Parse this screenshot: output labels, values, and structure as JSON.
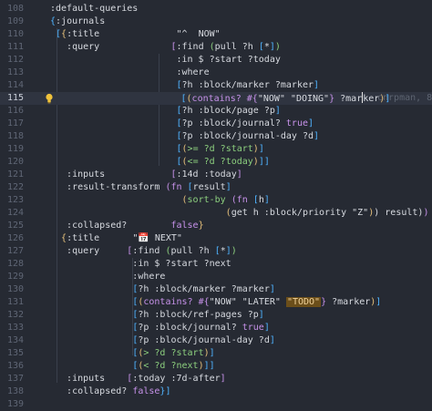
{
  "editor": {
    "blame_text": "cnrpman, 8",
    "lines": [
      {
        "n": "108",
        "segs": [
          [
            ":default-queries",
            "kw"
          ]
        ]
      },
      {
        "n": "109",
        "segs": [
          [
            "{",
            "br"
          ],
          [
            ":journals",
            "kw"
          ]
        ]
      },
      {
        "n": "110",
        "segs": [
          [
            " [",
            "br"
          ],
          [
            "{",
            "y"
          ],
          [
            ":title              ",
            "kw"
          ],
          [
            "\"^  NOW\"",
            "str"
          ]
        ]
      },
      {
        "n": "111",
        "segs": [
          [
            "   :query             ",
            "kw"
          ],
          [
            "[",
            "p"
          ],
          [
            ":find ",
            "kw"
          ],
          [
            "(",
            "g"
          ],
          [
            "pull ?h ",
            "kw"
          ],
          [
            "[",
            "br"
          ],
          [
            "*",
            "kw"
          ],
          [
            "]",
            "br"
          ],
          [
            ")",
            "g"
          ]
        ]
      },
      {
        "n": "112",
        "segs": [
          [
            "                       :in $ ?start ?today",
            "kw"
          ]
        ]
      },
      {
        "n": "113",
        "segs": [
          [
            "                       :where",
            "kw"
          ]
        ]
      },
      {
        "n": "114",
        "segs": [
          [
            "                       ",
            "kw"
          ],
          [
            "[",
            "br"
          ],
          [
            "?h :block/marker ?marker",
            "kw"
          ],
          [
            "]",
            "br"
          ]
        ]
      },
      {
        "n": "115",
        "segs": [
          [
            "                       ",
            "kw"
          ],
          [
            "[",
            "br"
          ],
          [
            "(",
            "y"
          ],
          [
            "contains? ",
            "fn"
          ],
          [
            "#{",
            "p"
          ],
          [
            "\"NOW\" \"DOING\"",
            "str"
          ],
          [
            "}",
            "p"
          ],
          [
            " ?mar",
            "kw"
          ],
          [
            "|",
            "cursor"
          ],
          [
            "ker",
            "kw"
          ],
          [
            ")",
            "y"
          ],
          [
            "]",
            "br"
          ]
        ],
        "current": true
      },
      {
        "n": "116",
        "segs": [
          [
            "                       ",
            "kw"
          ],
          [
            "[",
            "br"
          ],
          [
            "?h :block/page ?p",
            "kw"
          ],
          [
            "]",
            "br"
          ]
        ]
      },
      {
        "n": "117",
        "segs": [
          [
            "                       ",
            "kw"
          ],
          [
            "[",
            "br"
          ],
          [
            "?p :block/journal? ",
            "kw"
          ],
          [
            "true",
            "bool"
          ],
          [
            "]",
            "br"
          ]
        ]
      },
      {
        "n": "118",
        "segs": [
          [
            "                       ",
            "kw"
          ],
          [
            "[",
            "br"
          ],
          [
            "?p :block/journal-day ?d",
            "kw"
          ],
          [
            "]",
            "br"
          ]
        ]
      },
      {
        "n": "119",
        "segs": [
          [
            "                       ",
            "kw"
          ],
          [
            "[",
            "br"
          ],
          [
            "(",
            "y"
          ],
          [
            ">= ?d ?start",
            "g"
          ],
          [
            ")",
            "y"
          ],
          [
            "]",
            "br"
          ]
        ]
      },
      {
        "n": "120",
        "segs": [
          [
            "                       ",
            "kw"
          ],
          [
            "[",
            "br"
          ],
          [
            "(",
            "y"
          ],
          [
            "<= ?d ?today",
            "g"
          ],
          [
            ")",
            "y"
          ],
          [
            "]]",
            "br"
          ]
        ]
      },
      {
        "n": "121",
        "segs": [
          [
            "   :inputs            ",
            "kw"
          ],
          [
            "[",
            "p"
          ],
          [
            ":14d :today",
            "kw"
          ],
          [
            "]",
            "p"
          ]
        ]
      },
      {
        "n": "122",
        "segs": [
          [
            "   :result-transform ",
            "kw"
          ],
          [
            "(",
            "p"
          ],
          [
            "fn ",
            "fn"
          ],
          [
            "[",
            "br"
          ],
          [
            "result",
            "kw"
          ],
          [
            "]",
            "br"
          ]
        ]
      },
      {
        "n": "123",
        "segs": [
          [
            "                        ",
            "kw"
          ],
          [
            "(",
            "y"
          ],
          [
            "sort-by ",
            "g"
          ],
          [
            "(",
            "p"
          ],
          [
            "fn ",
            "fn"
          ],
          [
            "[",
            "br"
          ],
          [
            "h",
            "kw"
          ],
          [
            "]",
            "br"
          ]
        ]
      },
      {
        "n": "124",
        "segs": [
          [
            "                                ",
            "kw"
          ],
          [
            "(",
            "y"
          ],
          [
            "get h :block/priority \"Z\"",
            "kw"
          ],
          [
            ")",
            "y"
          ],
          [
            ") result",
            ""
          ],
          [
            ")",
            ""
          ],
          [
            ")",
            "p"
          ]
        ]
      },
      {
        "n": "125",
        "segs": [
          [
            "   :collapsed?        ",
            "kw"
          ],
          [
            "false",
            "bool"
          ],
          [
            "}",
            "y"
          ]
        ]
      },
      {
        "n": "126",
        "segs": [
          [
            "  ",
            "kw"
          ],
          [
            "{",
            "y"
          ],
          [
            ":title      ",
            "kw"
          ],
          [
            "\"📅 NEXT\"",
            "str"
          ]
        ]
      },
      {
        "n": "127",
        "segs": [
          [
            "   :query     ",
            "kw"
          ],
          [
            "[",
            "p"
          ],
          [
            ":find ",
            "kw"
          ],
          [
            "(",
            "g"
          ],
          [
            "pull ?h ",
            "kw"
          ],
          [
            "[",
            "br"
          ],
          [
            "*",
            "kw"
          ],
          [
            "]",
            "br"
          ],
          [
            ")",
            "g"
          ]
        ]
      },
      {
        "n": "128",
        "segs": [
          [
            "               :in $ ?start ?next",
            "kw"
          ]
        ]
      },
      {
        "n": "129",
        "segs": [
          [
            "               :where",
            "kw"
          ]
        ]
      },
      {
        "n": "130",
        "segs": [
          [
            "               ",
            "kw"
          ],
          [
            "[",
            "br"
          ],
          [
            "?h :block/marker ?marker",
            "kw"
          ],
          [
            "]",
            "br"
          ]
        ]
      },
      {
        "n": "131",
        "segs": [
          [
            "               ",
            "kw"
          ],
          [
            "[",
            "br"
          ],
          [
            "(",
            "y"
          ],
          [
            "contains? ",
            "fn"
          ],
          [
            "#{",
            "p"
          ],
          [
            "\"NOW\" \"LATER\" ",
            "str"
          ],
          [
            "\"TODO\"",
            "todo"
          ],
          [
            "}",
            "p"
          ],
          [
            " ?marker",
            "kw"
          ],
          [
            ")",
            "y"
          ],
          [
            "]",
            "br"
          ]
        ]
      },
      {
        "n": "132",
        "segs": [
          [
            "               ",
            "kw"
          ],
          [
            "[",
            "br"
          ],
          [
            "?h :block/ref-pages ?p",
            "kw"
          ],
          [
            "]",
            "br"
          ]
        ]
      },
      {
        "n": "133",
        "segs": [
          [
            "               ",
            "kw"
          ],
          [
            "[",
            "br"
          ],
          [
            "?p :block/journal? ",
            "kw"
          ],
          [
            "true",
            "bool"
          ],
          [
            "]",
            "br"
          ]
        ]
      },
      {
        "n": "134",
        "segs": [
          [
            "               ",
            "kw"
          ],
          [
            "[",
            "br"
          ],
          [
            "?p :block/journal-day ?d",
            "kw"
          ],
          [
            "]",
            "br"
          ]
        ]
      },
      {
        "n": "135",
        "segs": [
          [
            "               ",
            "kw"
          ],
          [
            "[",
            "br"
          ],
          [
            "(",
            "y"
          ],
          [
            "> ?d ?start",
            "g"
          ],
          [
            ")",
            "y"
          ],
          [
            "]",
            "br"
          ]
        ]
      },
      {
        "n": "136",
        "segs": [
          [
            "               ",
            "kw"
          ],
          [
            "[",
            "br"
          ],
          [
            "(",
            "y"
          ],
          [
            "< ?d ?next",
            "g"
          ],
          [
            ")",
            "y"
          ],
          [
            "]]",
            "br"
          ]
        ]
      },
      {
        "n": "137",
        "segs": [
          [
            "   :inputs    ",
            "kw"
          ],
          [
            "[",
            "p"
          ],
          [
            ":today :7d-after",
            "kw"
          ],
          [
            "]",
            "p"
          ]
        ]
      },
      {
        "n": "138",
        "segs": [
          [
            "   :collapsed? ",
            "kw"
          ],
          [
            "false",
            "bool"
          ],
          [
            "}]",
            "br"
          ]
        ]
      },
      {
        "n": "139",
        "segs": []
      }
    ]
  }
}
